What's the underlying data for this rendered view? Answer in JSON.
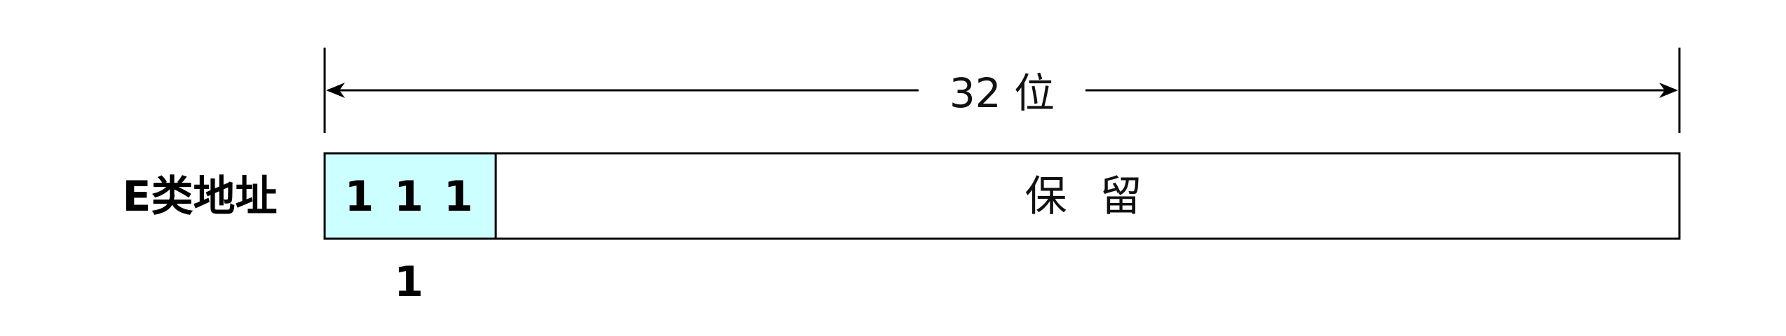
{
  "dimension": {
    "label": "32 位"
  },
  "address_row": {
    "label": "E类地址",
    "fields": [
      {
        "text": "1 1 1 1",
        "fill": "#ccffff"
      },
      {
        "text": "保 留",
        "fill": "#ffffff"
      }
    ]
  },
  "colors": {
    "stroke": "#000000",
    "prefix_fill": "#ccffff",
    "background": "#ffffff"
  }
}
